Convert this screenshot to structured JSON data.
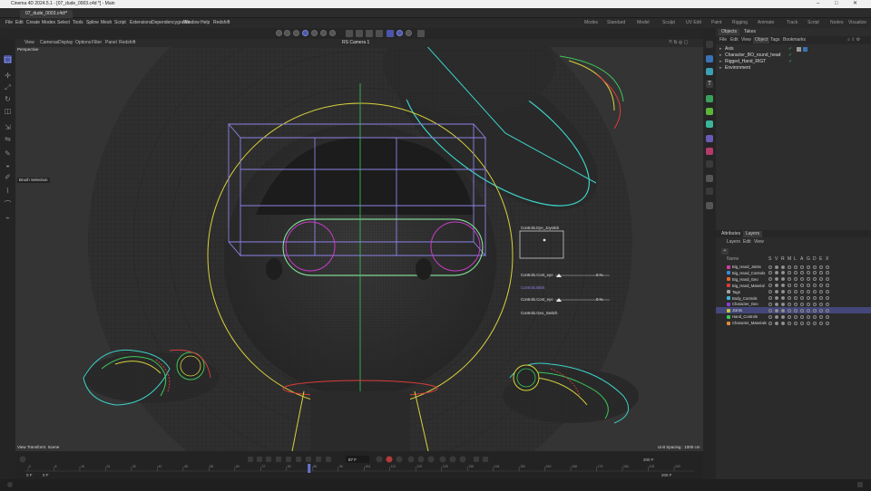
{
  "window": {
    "title": "Cinema 4D 2024.5.1 - [07_dude_0003.c4d *] - Main",
    "controls": [
      "–",
      "□",
      "✕"
    ]
  },
  "document_tabs": [
    {
      "label": "07_dude_0003.c4d *"
    },
    {
      "label": "+"
    }
  ],
  "menubar": {
    "items": [
      "File",
      "Edit",
      "Create",
      "Modes",
      "Select",
      "Tools",
      "Spline",
      "Mesh",
      "Script",
      "Extensions",
      "Dependencygrafiks",
      "Window",
      "Help",
      "Redshift"
    ],
    "layouts": [
      "Modes",
      "Standard",
      "Model",
      "Sculpt",
      "UV Edit",
      "Paint",
      "Rigging",
      "Animate",
      "Track",
      "Script",
      "Nodes",
      "Visualize"
    ]
  },
  "viewport": {
    "menu": [
      "View",
      "Cameras",
      "Display",
      "Options",
      "Filter",
      "Panel",
      "Redshift"
    ],
    "camera_label": "RS Camera 1",
    "view_name": "Perspective",
    "tool_tip": "Brush Selection",
    "footer_left": "View Transform: Scene",
    "footer_right": "Unit Spacing : 1000 cm",
    "control_labels": [
      "Controls.Eye_Joystick",
      "Controls.Cont_eye",
      "Controls.Blink",
      "Controls.Cont_eye",
      "Controls.Geo_Switch"
    ],
    "slider_values": [
      "0 %",
      "0 %"
    ]
  },
  "object_manager": {
    "tabs": [
      "Objects",
      "Takes"
    ],
    "menu": [
      "File",
      "Edit",
      "View",
      "Object",
      "Tags",
      "Bookmarks"
    ],
    "objects": [
      {
        "name": "Axis"
      },
      {
        "name": "Character_BO_round_head"
      },
      {
        "name": "Rigged_Hand_RIGT"
      },
      {
        "name": "Environment"
      }
    ]
  },
  "layer_manager": {
    "tabs": [
      "Attributes",
      "Layers"
    ],
    "menu": [
      "Layers",
      "Edit",
      "View"
    ],
    "column_name": "Name",
    "column_flags": [
      "S",
      "V",
      "R",
      "M",
      "L",
      "A",
      "G",
      "D",
      "E",
      "X"
    ],
    "layers": [
      {
        "name": "Big_Hand_Joints",
        "color": "#d23ca0"
      },
      {
        "name": "Big_Hand_Controls",
        "color": "#3c8cdc"
      },
      {
        "name": "Big_Hand_Geo",
        "color": "#e06a2a"
      },
      {
        "name": "Big_Hand_Material",
        "color": "#dc3c3c"
      },
      {
        "name": "Tags",
        "color": "#a0a0a0"
      },
      {
        "name": "Body_Controls",
        "color": "#3cb4dc"
      },
      {
        "name": "Character_Geo",
        "color": "#8c3cdc"
      },
      {
        "name": "Joints",
        "color": "#c8c83c",
        "selected": true
      },
      {
        "name": "Hand_Controls",
        "color": "#3cc85a"
      },
      {
        "name": "Character_Materials",
        "color": "#dc8c3c"
      }
    ]
  },
  "timeline": {
    "current_frame": "87 F",
    "end_frame": "200 F",
    "end_frame_2": "200 F",
    "start_frame": "0 F",
    "start_frame_2": "0 F",
    "ruler_ticks": [
      "0",
      "8",
      "16",
      "24",
      "32",
      "40",
      "48",
      "56",
      "64",
      "72",
      "80",
      "88",
      "96",
      "104",
      "112",
      "120",
      "128",
      "136",
      "144",
      "152",
      "160",
      "168",
      "176",
      "184",
      "192",
      "200"
    ]
  },
  "colors": {
    "accent": "#4c56a8",
    "yellow_control": "#d8d23c",
    "magenta_control": "#c83cc8",
    "cyan_control": "#3cd2c8",
    "green_control": "#3cc85a",
    "red_control": "#dc3c3c",
    "box_purple": "#8c82e6"
  }
}
